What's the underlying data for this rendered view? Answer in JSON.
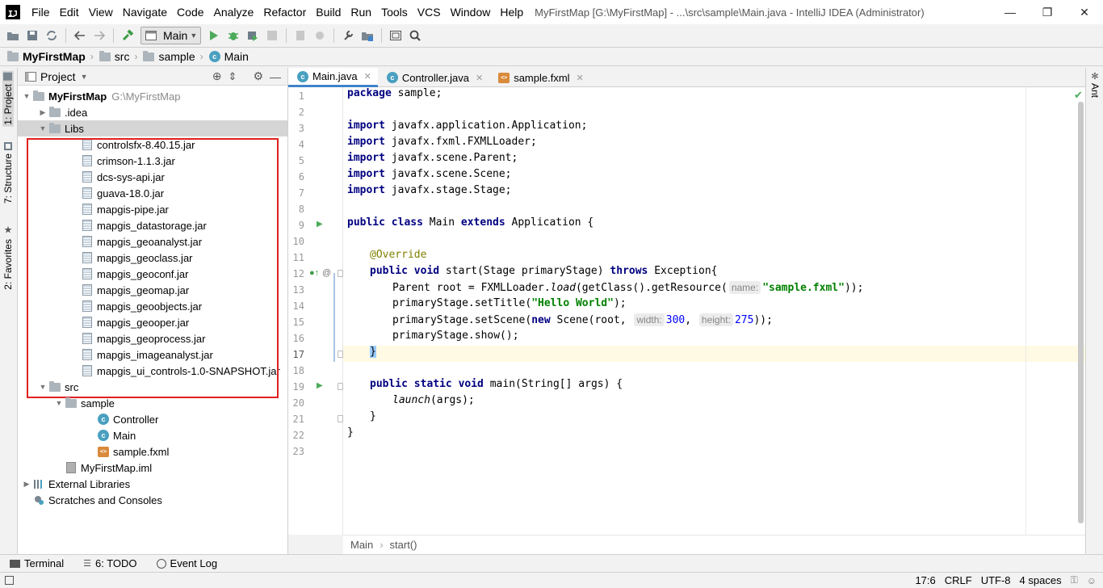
{
  "window": {
    "title": "MyFirstMap [G:\\MyFirstMap] - ...\\src\\sample\\Main.java - IntelliJ IDEA (Administrator)",
    "logo_text": "IJ",
    "controls": {
      "minimize": "—",
      "maximize": "❐",
      "close": "✕"
    }
  },
  "menu": [
    "File",
    "Edit",
    "View",
    "Navigate",
    "Code",
    "Analyze",
    "Refactor",
    "Build",
    "Run",
    "Tools",
    "VCS",
    "Window",
    "Help"
  ],
  "toolbar": {
    "run_config": "Main",
    "icons": [
      "open-icon",
      "save-icon",
      "sync-icon",
      "back-icon",
      "forward-icon",
      "build-icon",
      "run-icon",
      "debug-icon",
      "coverage-icon",
      "stop-icon",
      "vcs-icon",
      "vcs-update-icon",
      "settings-icon",
      "project-structure-icon",
      "terminal-window-icon",
      "search-icon"
    ]
  },
  "nav_breadcrumb": [
    "MyFirstMap",
    "src",
    "sample",
    "Main"
  ],
  "left_tool_tabs": [
    {
      "label": "1: Project",
      "icon": "folder-icon"
    },
    {
      "label": "7: Structure",
      "icon": "structure-icon"
    },
    {
      "label": "2: Favorites",
      "icon": "star-icon"
    }
  ],
  "right_tool_tabs": [
    {
      "label": "Ant",
      "icon": "ant-icon"
    }
  ],
  "project_panel": {
    "title": "Project",
    "tree": [
      {
        "label": "MyFirstMap",
        "sub": "G:\\MyFirstMap",
        "icon": "folder",
        "indent": 0,
        "arrow": "▼",
        "bold": true
      },
      {
        "label": ".idea",
        "icon": "folder",
        "indent": 1,
        "arrow": "▶"
      },
      {
        "label": "Libs",
        "icon": "folder",
        "indent": 1,
        "arrow": "▼",
        "selected": true
      },
      {
        "label": "controlsfx-8.40.15.jar",
        "icon": "jar",
        "indent": 3
      },
      {
        "label": "crimson-1.1.3.jar",
        "icon": "jar",
        "indent": 3
      },
      {
        "label": "dcs-sys-api.jar",
        "icon": "jar",
        "indent": 3
      },
      {
        "label": "guava-18.0.jar",
        "icon": "jar",
        "indent": 3
      },
      {
        "label": "mapgis-pipe.jar",
        "icon": "jar",
        "indent": 3
      },
      {
        "label": "mapgis_datastorage.jar",
        "icon": "jar",
        "indent": 3
      },
      {
        "label": "mapgis_geoanalyst.jar",
        "icon": "jar",
        "indent": 3
      },
      {
        "label": "mapgis_geoclass.jar",
        "icon": "jar",
        "indent": 3
      },
      {
        "label": "mapgis_geoconf.jar",
        "icon": "jar",
        "indent": 3
      },
      {
        "label": "mapgis_geomap.jar",
        "icon": "jar",
        "indent": 3
      },
      {
        "label": "mapgis_geoobjects.jar",
        "icon": "jar",
        "indent": 3
      },
      {
        "label": "mapgis_geooper.jar",
        "icon": "jar",
        "indent": 3
      },
      {
        "label": "mapgis_geoprocess.jar",
        "icon": "jar",
        "indent": 3
      },
      {
        "label": "mapgis_imageanalyst.jar",
        "icon": "jar",
        "indent": 3
      },
      {
        "label": "mapgis_ui_controls-1.0-SNAPSHOT.jar",
        "icon": "jar",
        "indent": 3
      },
      {
        "label": "src",
        "icon": "folder",
        "indent": 1,
        "arrow": "▼"
      },
      {
        "label": "sample",
        "icon": "folder",
        "indent": 2,
        "arrow": "▼"
      },
      {
        "label": "Controller",
        "icon": "class",
        "indent": 4
      },
      {
        "label": "Main",
        "icon": "class",
        "indent": 4
      },
      {
        "label": "sample.fxml",
        "icon": "fxml",
        "indent": 4
      },
      {
        "label": "MyFirstMap.iml",
        "icon": "iml",
        "indent": 2
      },
      {
        "label": "External Libraries",
        "icon": "libs",
        "indent": 0,
        "arrow": "▶"
      },
      {
        "label": "Scratches and Consoles",
        "icon": "scratch",
        "indent": 0
      }
    ]
  },
  "editor": {
    "tabs": [
      {
        "label": "Main.java",
        "icon": "class",
        "active": true
      },
      {
        "label": "Controller.java",
        "icon": "class",
        "active": false
      },
      {
        "label": "sample.fxml",
        "icon": "fxml",
        "active": false
      }
    ],
    "line_numbers": [
      "1",
      "2",
      "3",
      "4",
      "5",
      "6",
      "7",
      "8",
      "9",
      "10",
      "11",
      "12",
      "13",
      "14",
      "15",
      "16",
      "17",
      "18",
      "19",
      "20",
      "21",
      "22",
      "23"
    ],
    "caret_line": 17,
    "code": {
      "l1_kw": "package",
      "l1_rest": " sample;",
      "l3_kw": "import",
      "l3_rest": " javafx.application.Application;",
      "l4_kw": "import",
      "l4_rest": " javafx.fxml.FXMLLoader;",
      "l5_kw": "import",
      "l5_rest": " javafx.scene.Parent;",
      "l6_kw": "import",
      "l6_rest": " javafx.scene.Scene;",
      "l7_kw": "import",
      "l7_rest": " javafx.stage.Stage;",
      "l9_kw1": "public class",
      "l9_mid": " Main ",
      "l9_kw2": "extends",
      "l9_rest": " Application {",
      "l11_ann": "@Override",
      "l12_kw1": "public void",
      "l12_mid": " start(Stage primaryStage) ",
      "l12_kw2": "throws",
      "l12_rest": " Exception{",
      "l13_a": "Parent root = FXMLLoader.",
      "l13_it": "load",
      "l13_b": "(getClass().getResource(",
      "l13_hint": "name:",
      "l13_str": "\"sample.fxml\"",
      "l13_c": "));",
      "l14_a": "primaryStage.setTitle(",
      "l14_str": "\"Hello World\"",
      "l14_b": ");",
      "l15_a": "primaryStage.setScene(",
      "l15_kw": "new",
      "l15_b": " Scene(root, ",
      "l15_hint1": "width:",
      "l15_num1": "300",
      "l15_c": ", ",
      "l15_hint2": "height:",
      "l15_num2": "275",
      "l15_d": "));",
      "l16": "primaryStage.show();",
      "l17": "}",
      "l19_kw1": "public static void",
      "l19_rest": " main(String[] args) {",
      "l20_it": "launch",
      "l20_rest": "(args);",
      "l21": "}",
      "l22": "}"
    },
    "breadcrumb": [
      "Main",
      "start()"
    ]
  },
  "bottom_tabs": [
    {
      "label": "Terminal",
      "icon": "terminal-icon"
    },
    {
      "label": "6: TODO",
      "icon": "todo-icon"
    },
    {
      "label": "Event Log",
      "icon": "event-log-icon"
    }
  ],
  "status": {
    "position": "17:6",
    "line_sep": "CRLF",
    "encoding": "UTF-8",
    "indent": "4 spaces"
  }
}
